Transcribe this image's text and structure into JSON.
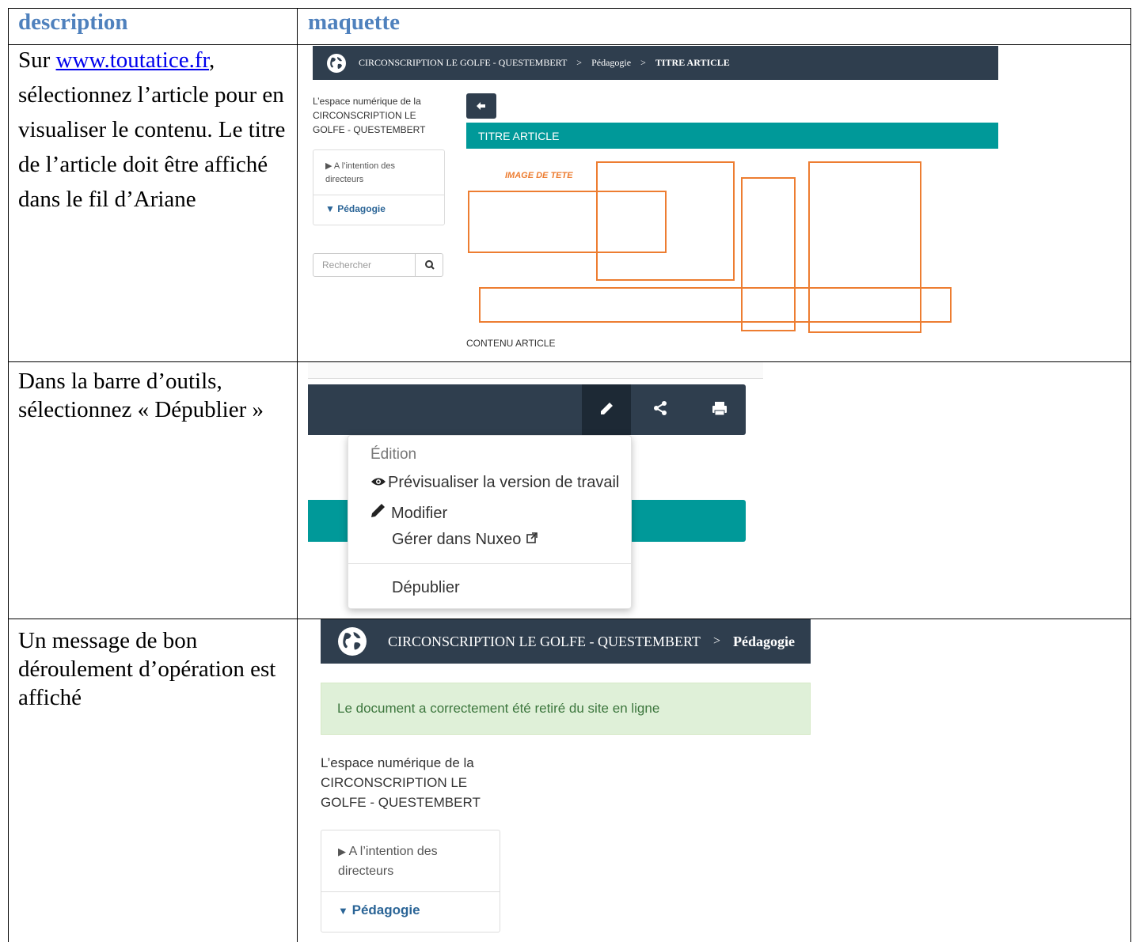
{
  "table": {
    "headers": {
      "description": "description",
      "maquette": "maquette"
    },
    "rows": [
      {
        "description": {
          "prefix": "Sur ",
          "link": "www.toutatice.fr",
          "rest": ", sélectionnez l’article pour en visualiser le contenu. Le titre de l’article doit être affiché dans le fil d’Ariane"
        }
      },
      {
        "description": {
          "text": "Dans la barre d’outils, sélectionnez « Dépublier »"
        }
      },
      {
        "description": {
          "text": "Un message de bon déroulement d’opération est affiché"
        }
      }
    ]
  },
  "mockup1": {
    "breadcrumb": [
      "CIRCONSCRIPTION LE GOLFE - QUESTEMBERT",
      ">",
      "Pédagogie",
      ">",
      "TITRE ARTICLE"
    ],
    "site_description": [
      "L’espace numérique de la",
      "CIRCONSCRIPTION LE",
      "GOLFE - QUESTEMBERT"
    ],
    "menu": [
      {
        "label1": "A l’intention des",
        "label2": "directeurs",
        "icon": "caret-right-icon"
      },
      {
        "label1": "Pédagogie",
        "icon": "caret-down-icon",
        "active": true
      }
    ],
    "search_placeholder": "Rechercher",
    "back_icon": "arrow-left-icon",
    "article_title": "TITRE ARTICLE",
    "image_label": "IMAGE DE TETE",
    "content_label": "CONTENU ARTICLE",
    "colors": {
      "navbar": "#2f3e4e",
      "teal": "#009999",
      "orange": "#ed7d31"
    }
  },
  "mockup2": {
    "toolbar_icons": [
      "pencil-icon",
      "share-icon",
      "print-icon"
    ],
    "dropdown": {
      "header": "Édition",
      "items": [
        {
          "label": "Prévisualiser la version de travail",
          "icon": "eye-icon"
        },
        {
          "label": "Modifier",
          "icon": "pencil-icon"
        },
        {
          "label": "Gérer dans Nuxeo",
          "icon": "external-link-icon"
        }
      ],
      "after_divider": "Dépublier"
    }
  },
  "mockup3": {
    "breadcrumb": [
      "CIRCONSCRIPTION LE GOLFE - QUESTEMBERT",
      ">",
      "Pédagogie"
    ],
    "alert": "Le document a correctement été retiré du site en ligne",
    "site_description": [
      "L’espace numérique de la",
      "CIRCONSCRIPTION LE",
      "GOLFE - QUESTEMBERT"
    ],
    "menu": [
      {
        "label1": "A l’intention des",
        "label2": "directeurs",
        "icon": "caret-right-icon"
      },
      {
        "label1": "Pédagogie",
        "icon": "caret-down-icon",
        "active": true
      }
    ],
    "colors": {
      "alert_bg": "#dff0d8",
      "alert_text": "#3c763d"
    }
  }
}
